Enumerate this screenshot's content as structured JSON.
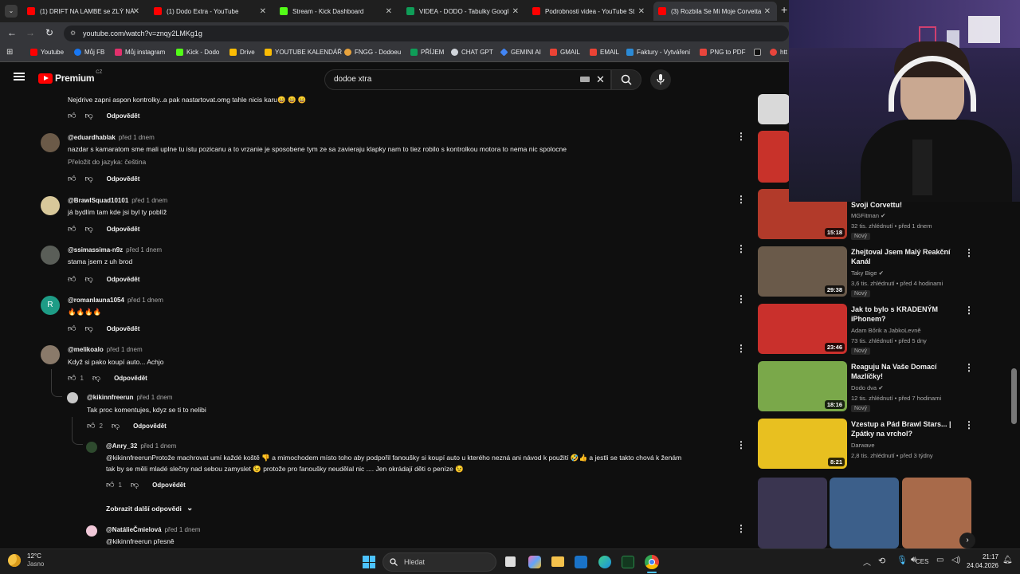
{
  "tabs": [
    {
      "label": "(1) DRIFT NA LAMBE se ZLÝ NÁ",
      "color": "#ff0000"
    },
    {
      "label": "(1) Dodo Extra - YouTube",
      "color": "#ff0000"
    },
    {
      "label": "Stream - Kick Dashboard",
      "color": "#53fc18"
    },
    {
      "label": "VIDEA - DODO - Tabulky Googl",
      "color": "#0f9d58"
    },
    {
      "label": "Podrobnosti videa - YouTube St",
      "color": "#ff0000"
    },
    {
      "label": "(3) Rozbila Se Mi Moje Corvetta",
      "color": "#ff0000"
    }
  ],
  "address": {
    "url": "youtube.com/watch?v=znqy2LMKg1g"
  },
  "bookmarks": [
    {
      "label": "Youtube",
      "color": "#ff0000"
    },
    {
      "label": "Můj FB",
      "color": "#1877f2"
    },
    {
      "label": "Můj instagram",
      "color": "#e1306c"
    },
    {
      "label": "Kick - Dodo",
      "color": "#53fc18"
    },
    {
      "label": "Drive",
      "color": "#fbbc04"
    },
    {
      "label": "YOUTUBE KALENDÁŘ",
      "color": "#fbbc04"
    },
    {
      "label": "FNGG - Dodoeu",
      "color": "#e8a33d"
    },
    {
      "label": "PŘÍJEM",
      "color": "#0f9d58"
    },
    {
      "label": "CHAT GPT",
      "color": "#d1d5db"
    },
    {
      "label": "GEMINI AI",
      "color": "#4285f4"
    },
    {
      "label": "GMAIL",
      "color": "#ea4335"
    },
    {
      "label": "EMAIL",
      "color": "#ea4335"
    },
    {
      "label": "Faktury - Vytváření",
      "color": "#2b8ad6"
    },
    {
      "label": "PNG to PDF",
      "color": "#e8453c"
    },
    {
      "label": "htt",
      "color": "#e8453c"
    }
  ],
  "youtube": {
    "logo": "Premium",
    "logo_region": "CZ",
    "search_value": "dodoe xtra"
  },
  "top_comment": {
    "text": "Nejdrive zapni aspon kontrolky..a pak nastartovat.omg tahle nicis karu😄 😄 😄",
    "reply": "Odpovědět"
  },
  "comments": [
    {
      "author": "@eduardhablak",
      "when": "před 1 dnem",
      "text": "nazdar s kamaratom sme mali uplne tu istu pozicanu  a to vrzanie je sposobene tym ze sa zavieraju klapky nam to tiez robilo s kontrolkou motora to nema nic spolocne",
      "translate": "Přeložit do jazyka: čeština",
      "reply": "Odpovědět"
    },
    {
      "author": "@BrawlSquad10101",
      "when": "před 1 dnem",
      "text": "já bydlím tam kde jsi byl ty poblíž",
      "reply": "Odpovědět"
    },
    {
      "author": "@ssimassima-n9z",
      "when": "před 1 dnem",
      "text": "stama jsem z uh brod",
      "reply": "Odpovědět"
    },
    {
      "author": "@romanlauna1054",
      "when": "před 1 dnem",
      "text": "🔥🔥🔥🔥",
      "reply": "Odpovědět"
    },
    {
      "author": "@melikoalo",
      "when": "před 1 dnem",
      "text": "Když si pako koupí auto... Achjo",
      "likes": "1",
      "reply": "Odpovědět"
    }
  ],
  "replies": [
    {
      "author": "@kikinnfreerun",
      "when": "před 1 dnem",
      "text": "Tak proc komentujes, kdyz se ti to nelibi",
      "likes": "2",
      "reply": "Odpovědět"
    },
    {
      "author": "@Anry_32",
      "when": "před 1 dnem",
      "text": "@kikinnfreerunProtože machrovat umí každé  koště 👎 a mimochodem místo toho aby podpořil fanoušky si koupí auto u kterého nezná ani návod k použití 🤣👍  a jestli se takto chová k ženám",
      "text2": "tak by se měli mladé slečny nad sebou zamyslet 😉 protože pro fanoušky neudělal nic .... Jen okrádají děti o peníze 😉",
      "likes": "1",
      "reply": "Odpovědět"
    },
    {
      "author": "@NatálieČmielová",
      "when": "před 1 dnem",
      "text": "@kikinnfreerun přesně"
    }
  ],
  "more_replies": "Zobrazit další odpovědi",
  "recommendations": [
    {
      "title": "Svoji Corvettu!",
      "channel": "MGFitman",
      "meta": "32 tis. zhlédnutí • před 1 dnem",
      "badge": "Nový",
      "duration": "15:18",
      "thumb_color": "#b23a2a"
    },
    {
      "title": "Zhejtoval Jsem Malý Reakční Kanál",
      "channel": "Taky Bige",
      "meta": "3,6 tis. zhlédnutí • před 4 hodinami",
      "badge": "Nový",
      "duration": "29:38",
      "thumb_color": "#6a5a4a"
    },
    {
      "title": "Jak to bylo s KRADENÝM iPhonem?",
      "channel": "Adam Bőrik a JabkoLevně",
      "meta": "73 tis. zhlédnutí • před 5 dny",
      "badge": "Nový",
      "duration": "23:46",
      "thumb_color": "#c9302c"
    },
    {
      "title": "Reaguju Na Vaše Domací Mazlíčky!",
      "channel": "Dodo dva",
      "meta": "12 tis. zhlédnutí • před 7 hodinami",
      "badge": "Nový",
      "duration": "18:16",
      "thumb_color": "#7aa84a"
    },
    {
      "title": "Vzestup a Pád Brawl Stars... | Zpátky na vrchol?",
      "channel": "Darwave",
      "meta": "2,8 tis. zhlédnutí • před 3 týdny",
      "duration": "8:21",
      "thumb_color": "#e8c020"
    }
  ],
  "taskbar": {
    "weather_temp": "12°C",
    "weather_desc": "Jasno",
    "search_placeholder": "Hledat",
    "lang": "CES",
    "time": "21:17",
    "date": "24.04.2026"
  }
}
